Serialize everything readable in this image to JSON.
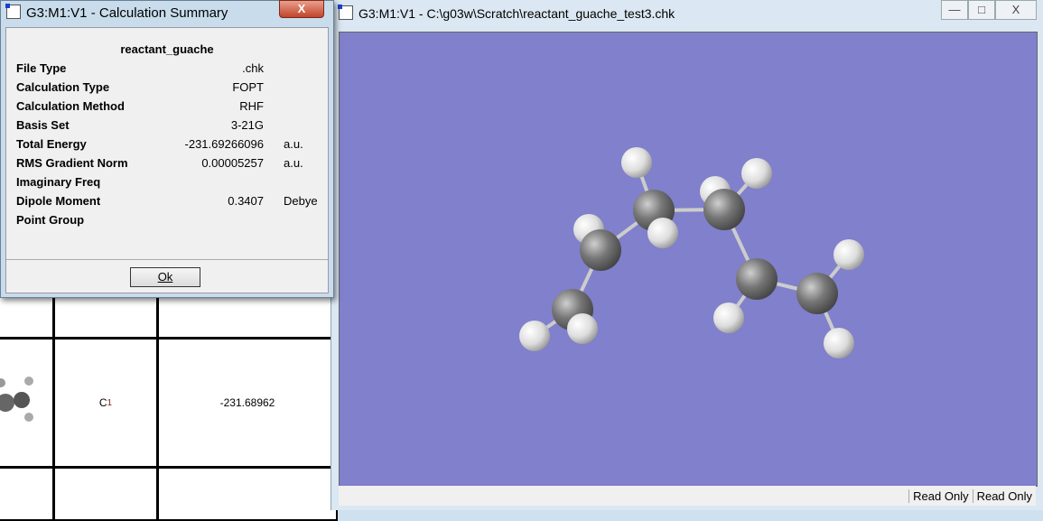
{
  "summary_dialog": {
    "title": "G3:M1:V1 - Calculation Summary",
    "close_label": "X",
    "heading": "reactant_guache",
    "rows": [
      {
        "label": "File Type",
        "value": ".chk",
        "unit": ""
      },
      {
        "label": "Calculation Type",
        "value": "FOPT",
        "unit": ""
      },
      {
        "label": "Calculation Method",
        "value": "RHF",
        "unit": ""
      },
      {
        "label": "Basis Set",
        "value": "3-21G",
        "unit": ""
      },
      {
        "label": "Total Energy",
        "value": "-231.69266096",
        "unit": "a.u."
      },
      {
        "label": "RMS Gradient Norm",
        "value": "0.00005257",
        "unit": "a.u."
      },
      {
        "label": "Imaginary Freq",
        "value": "",
        "unit": ""
      },
      {
        "label": "Dipole Moment",
        "value": "0.3407",
        "unit": "Debye"
      },
      {
        "label": "Point Group",
        "value": "",
        "unit": ""
      }
    ],
    "ok_label": "Ok"
  },
  "background_table": {
    "point_group": "C",
    "point_group_sub": "1",
    "energy": "-231.68962"
  },
  "viewer_window": {
    "title": "G3:M1:V1 - C:\\g03w\\Scratch\\reactant_guache_test3.chk",
    "minimize": "—",
    "maximize": "□",
    "close": "X",
    "status": [
      "Read Only",
      "Read Only"
    ],
    "background_color": "#8080cc"
  }
}
